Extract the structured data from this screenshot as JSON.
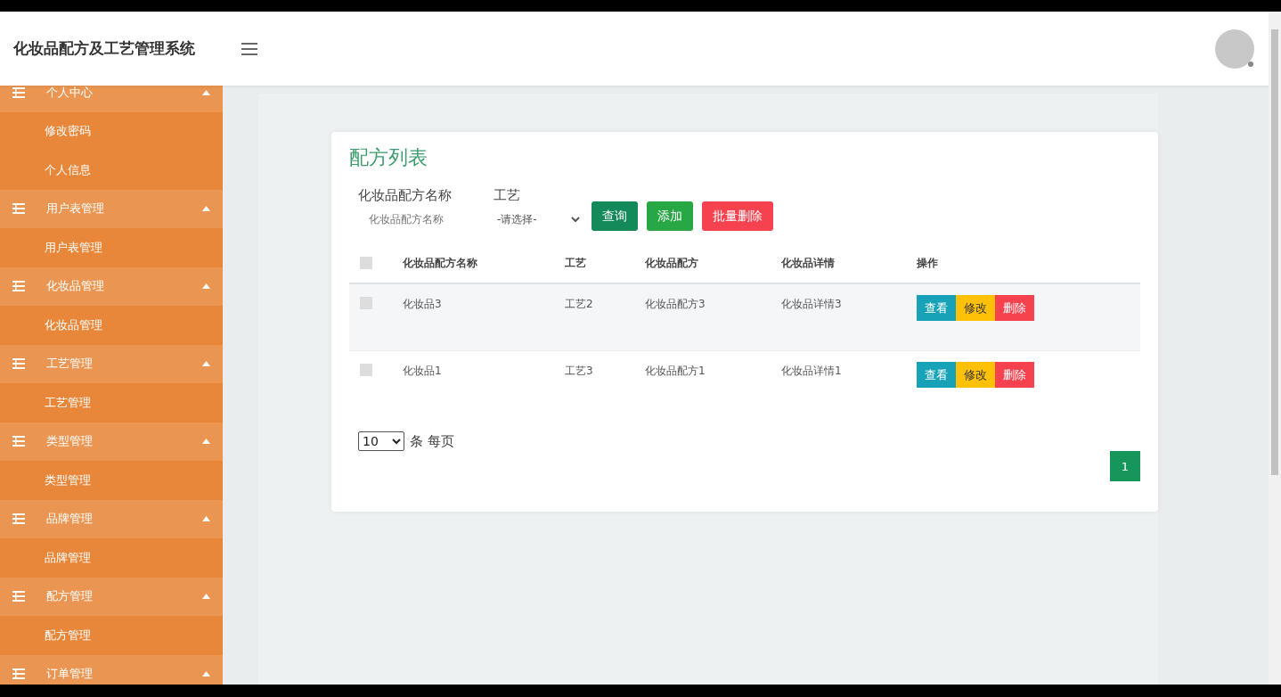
{
  "header": {
    "title": "化妆品配方及工艺管理系统"
  },
  "sidebar": {
    "groups": [
      {
        "label": "个人中心",
        "expanded": true,
        "children": [
          {
            "label": "修改密码"
          },
          {
            "label": "个人信息"
          }
        ]
      },
      {
        "label": "用户表管理",
        "expanded": true,
        "children": [
          {
            "label": "用户表管理"
          }
        ]
      },
      {
        "label": "化妆品管理",
        "expanded": true,
        "children": [
          {
            "label": "化妆品管理"
          }
        ]
      },
      {
        "label": "工艺管理",
        "expanded": true,
        "children": [
          {
            "label": "工艺管理"
          }
        ]
      },
      {
        "label": "类型管理",
        "expanded": true,
        "children": [
          {
            "label": "类型管理"
          }
        ]
      },
      {
        "label": "品牌管理",
        "expanded": true,
        "children": [
          {
            "label": "品牌管理"
          }
        ]
      },
      {
        "label": "配方管理",
        "expanded": true,
        "children": [
          {
            "label": "配方管理"
          }
        ]
      },
      {
        "label": "订单管理",
        "expanded": true
      }
    ]
  },
  "card": {
    "title": "配方列表",
    "filters": [
      {
        "kind": "input",
        "label": "化妆品配方名称",
        "placeholder": "化妆品配方名称"
      },
      {
        "kind": "select",
        "label": "工艺",
        "value": "-请选择-"
      }
    ],
    "buttons": [
      {
        "label": "查询",
        "kind": "search"
      },
      {
        "label": "添加",
        "kind": "add"
      },
      {
        "label": "批量删除",
        "kind": "delete"
      }
    ],
    "table": {
      "all_checked": false,
      "columns": [
        "化妆品配方名称",
        "工艺",
        "化妆品配方",
        "化妆品详情",
        "操作"
      ],
      "rows": [
        {
          "checked": false,
          "cells": [
            "化妆品3",
            "工艺2",
            "化妆品配方3",
            "化妆品详情3"
          ],
          "actions": [
            {
              "label": "查看",
              "kind": "view"
            },
            {
              "label": "修改",
              "kind": "edit"
            },
            {
              "label": "删除",
              "kind": "delete"
            }
          ]
        },
        {
          "checked": false,
          "cells": [
            "化妆品1",
            "工艺3",
            "化妆品配方1",
            "化妆品详情1"
          ],
          "actions": [
            {
              "label": "查看",
              "kind": "view"
            },
            {
              "label": "修改",
              "kind": "edit"
            },
            {
              "label": "删除",
              "kind": "delete"
            }
          ]
        }
      ]
    },
    "page_size": {
      "value": "10",
      "suffix": "条 每页"
    },
    "pages": [
      {
        "label": "1",
        "selected": true
      }
    ]
  }
}
